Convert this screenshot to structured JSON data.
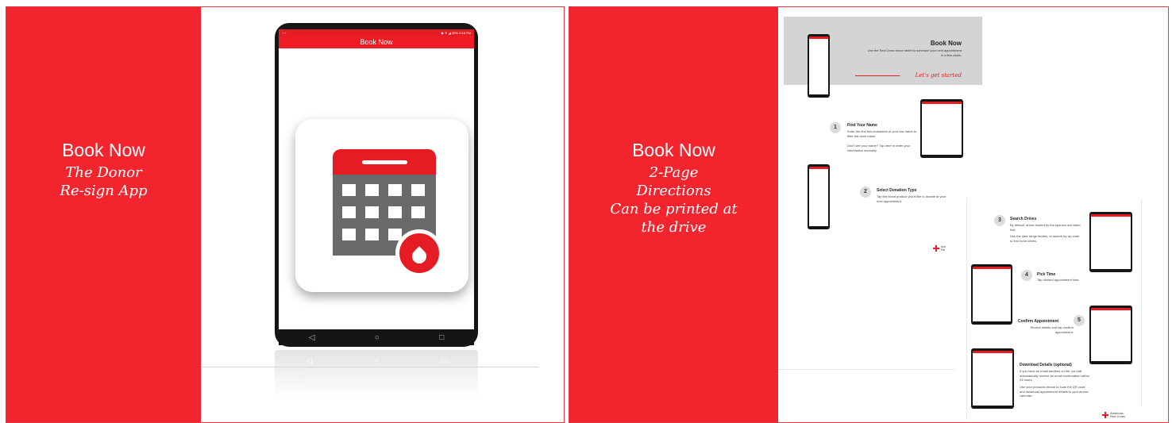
{
  "slide1": {
    "panel": {
      "title": "Book Now",
      "line1": "The Donor",
      "line2": "Re-sign App"
    },
    "tablet": {
      "status_left": "↓ ⌁",
      "status_right": "◆ ▼ ◢ 35% 3:18 PM",
      "app_bar_title": "Book Now",
      "nav_back": "◁",
      "nav_home": "○",
      "nav_recent": "□"
    }
  },
  "slide2": {
    "panel": {
      "title": "Book Now",
      "line1": "2-Page",
      "line2": "Directions",
      "line3": "Can be printed at",
      "line4": "the drive"
    },
    "page1": {
      "hero_title": "Book Now",
      "hero_sub": "Use the Red Cross donor tablet to schedule your next appointment in a few clicks.",
      "hero_cta": "Let's get started",
      "step1": {
        "num": "1",
        "title": "Find Your Name",
        "desc": "Enter the first few characters of your last name to filter the drive roster.",
        "hint": "Don't see your name? Tap here to enter your information manually."
      },
      "step2": {
        "num": "2",
        "title": "Select Donation Type",
        "desc": "Tap the blood product you'd like to donate at your next appointment."
      },
      "logo_line1": "Am",
      "logo_line2": "Re"
    },
    "page2": {
      "step3": {
        "num": "3",
        "title": "Search Drives",
        "desc1": "By default, drives hosted by the sponsor are listed first.",
        "desc2": "Use the date range finders, or search by zip code to find more drives."
      },
      "step4": {
        "num": "4",
        "title": "Pick Time",
        "desc": "Tap desired appointment time."
      },
      "step5": {
        "num": "5",
        "title": "Confirm Appointment",
        "desc": "Review details and tap confirm appointment."
      },
      "download": {
        "title": "Download Details (optional)",
        "desc1": "If you have an email address on file, you will automatically receive an email confirmation within 24 hours.",
        "desc2": "Use your personal device to scan the QR code and download appointment details to your device calendar."
      },
      "logo_line1": "American",
      "logo_line2": "Red Cross"
    }
  }
}
